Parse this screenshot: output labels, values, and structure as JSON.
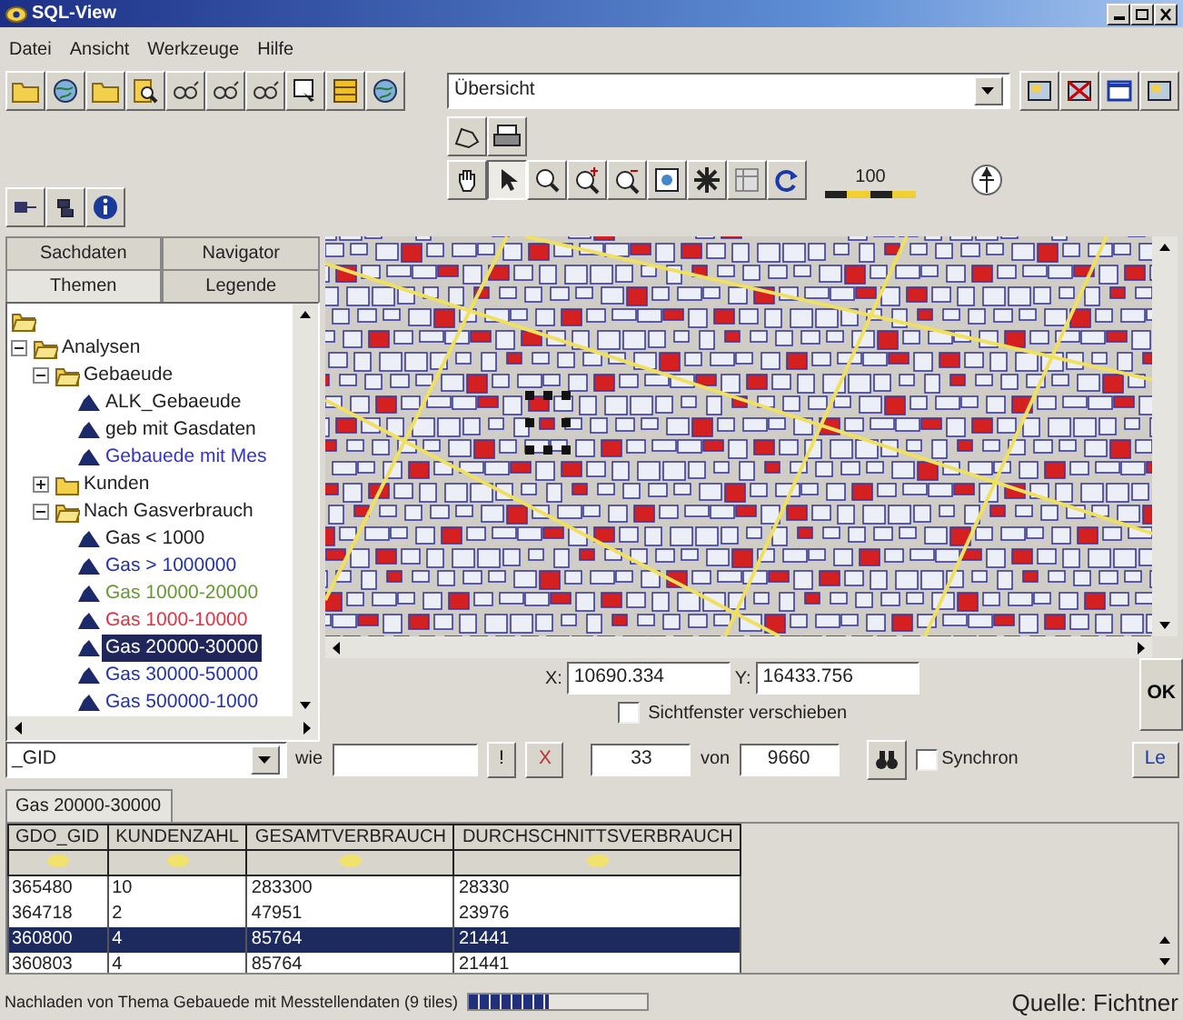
{
  "window": {
    "title": "SQL-View"
  },
  "menu": [
    "Datei",
    "Ansicht",
    "Werkzeuge",
    "Hilfe"
  ],
  "view_select": {
    "value": "Übersicht"
  },
  "scale": {
    "label": "100"
  },
  "panel_tab_rows": [
    {
      "tabs": [
        {
          "label": "Sachdaten",
          "selected": false
        },
        {
          "label": "Navigator",
          "selected": false
        }
      ]
    },
    {
      "tabs": [
        {
          "label": "Themen",
          "selected": true
        },
        {
          "label": "Legende",
          "selected": false
        }
      ]
    }
  ],
  "tree": [
    {
      "kind": "folder",
      "expanded": true,
      "children": [
        {
          "kind": "folder",
          "label": "Analysen",
          "expanded": true,
          "children": [
            {
              "kind": "folder",
              "label": "Gebaeude",
              "expanded": true,
              "children": [
                {
                  "kind": "layer",
                  "label": "ALK_Gebaeude",
                  "color": "#202020",
                  "selected": false
                },
                {
                  "kind": "layer",
                  "label": "geb mit Gasdaten",
                  "color": "#202020",
                  "selected": false
                },
                {
                  "kind": "layer",
                  "label": "Gebauede mit Mes",
                  "color": "#3333cc",
                  "selected": false
                }
              ]
            },
            {
              "kind": "folder",
              "label": "Kunden",
              "expanded": false
            },
            {
              "kind": "folder",
              "label": "Nach Gasverbrauch",
              "expanded": true,
              "children": [
                {
                  "kind": "layer",
                  "label": "Gas < 1000",
                  "color": "#202020",
                  "selected": false
                },
                {
                  "kind": "layer",
                  "label": "Gas > 1000000",
                  "color": "#2233aa",
                  "selected": false
                },
                {
                  "kind": "layer",
                  "label": "Gas 10000-20000",
                  "color": "#669933",
                  "selected": false
                },
                {
                  "kind": "layer",
                  "label": "Gas 1000-10000",
                  "color": "#dd3344",
                  "selected": false
                },
                {
                  "kind": "layer",
                  "label": "Gas 20000-30000",
                  "selected": true
                },
                {
                  "kind": "layer",
                  "label": "Gas 30000-50000",
                  "color": "#2233aa",
                  "selected": false
                },
                {
                  "kind": "layer",
                  "label": "Gas 500000-1000",
                  "color": "#2233aa",
                  "selected": false
                }
              ]
            }
          ]
        }
      ]
    }
  ],
  "coordinates": {
    "x_label": "X:",
    "x_value": "10690.334",
    "y_label": "Y:",
    "y_value": "16433.756"
  },
  "move_view": {
    "label": "Sichtfenster verschieben",
    "checked": false
  },
  "ok_button": "OK",
  "query": {
    "field": "_GID",
    "op_label": "wie",
    "run": "!",
    "clear": "X",
    "current": "33",
    "of_label": "von",
    "total": "9660",
    "sync": {
      "label": "Synchron",
      "checked": false
    },
    "more": "Le"
  },
  "result_tab": "Gas 20000-30000",
  "table": {
    "columns": [
      "GDO_GID",
      "KUNDENZAHL",
      "GESAMTVERBRAUCH",
      "DURCHSCHNITTSVERBRAUCH"
    ],
    "rows": [
      {
        "cells": [
          "365480",
          "10",
          "283300",
          "28330"
        ],
        "selected": false
      },
      {
        "cells": [
          "364718",
          "2",
          "47951",
          "23976"
        ],
        "selected": false
      },
      {
        "cells": [
          "360800",
          "4",
          "85764",
          "21441"
        ],
        "selected": true
      },
      {
        "cells": [
          "360803",
          "4",
          "85764",
          "21441"
        ],
        "selected": false
      }
    ]
  },
  "status_bar": {
    "text": "Nachladen von Thema Gebauede mit Messtellendaten (9 tiles)",
    "level": 0.45
  },
  "caption": "Quelle: Fichtner"
}
